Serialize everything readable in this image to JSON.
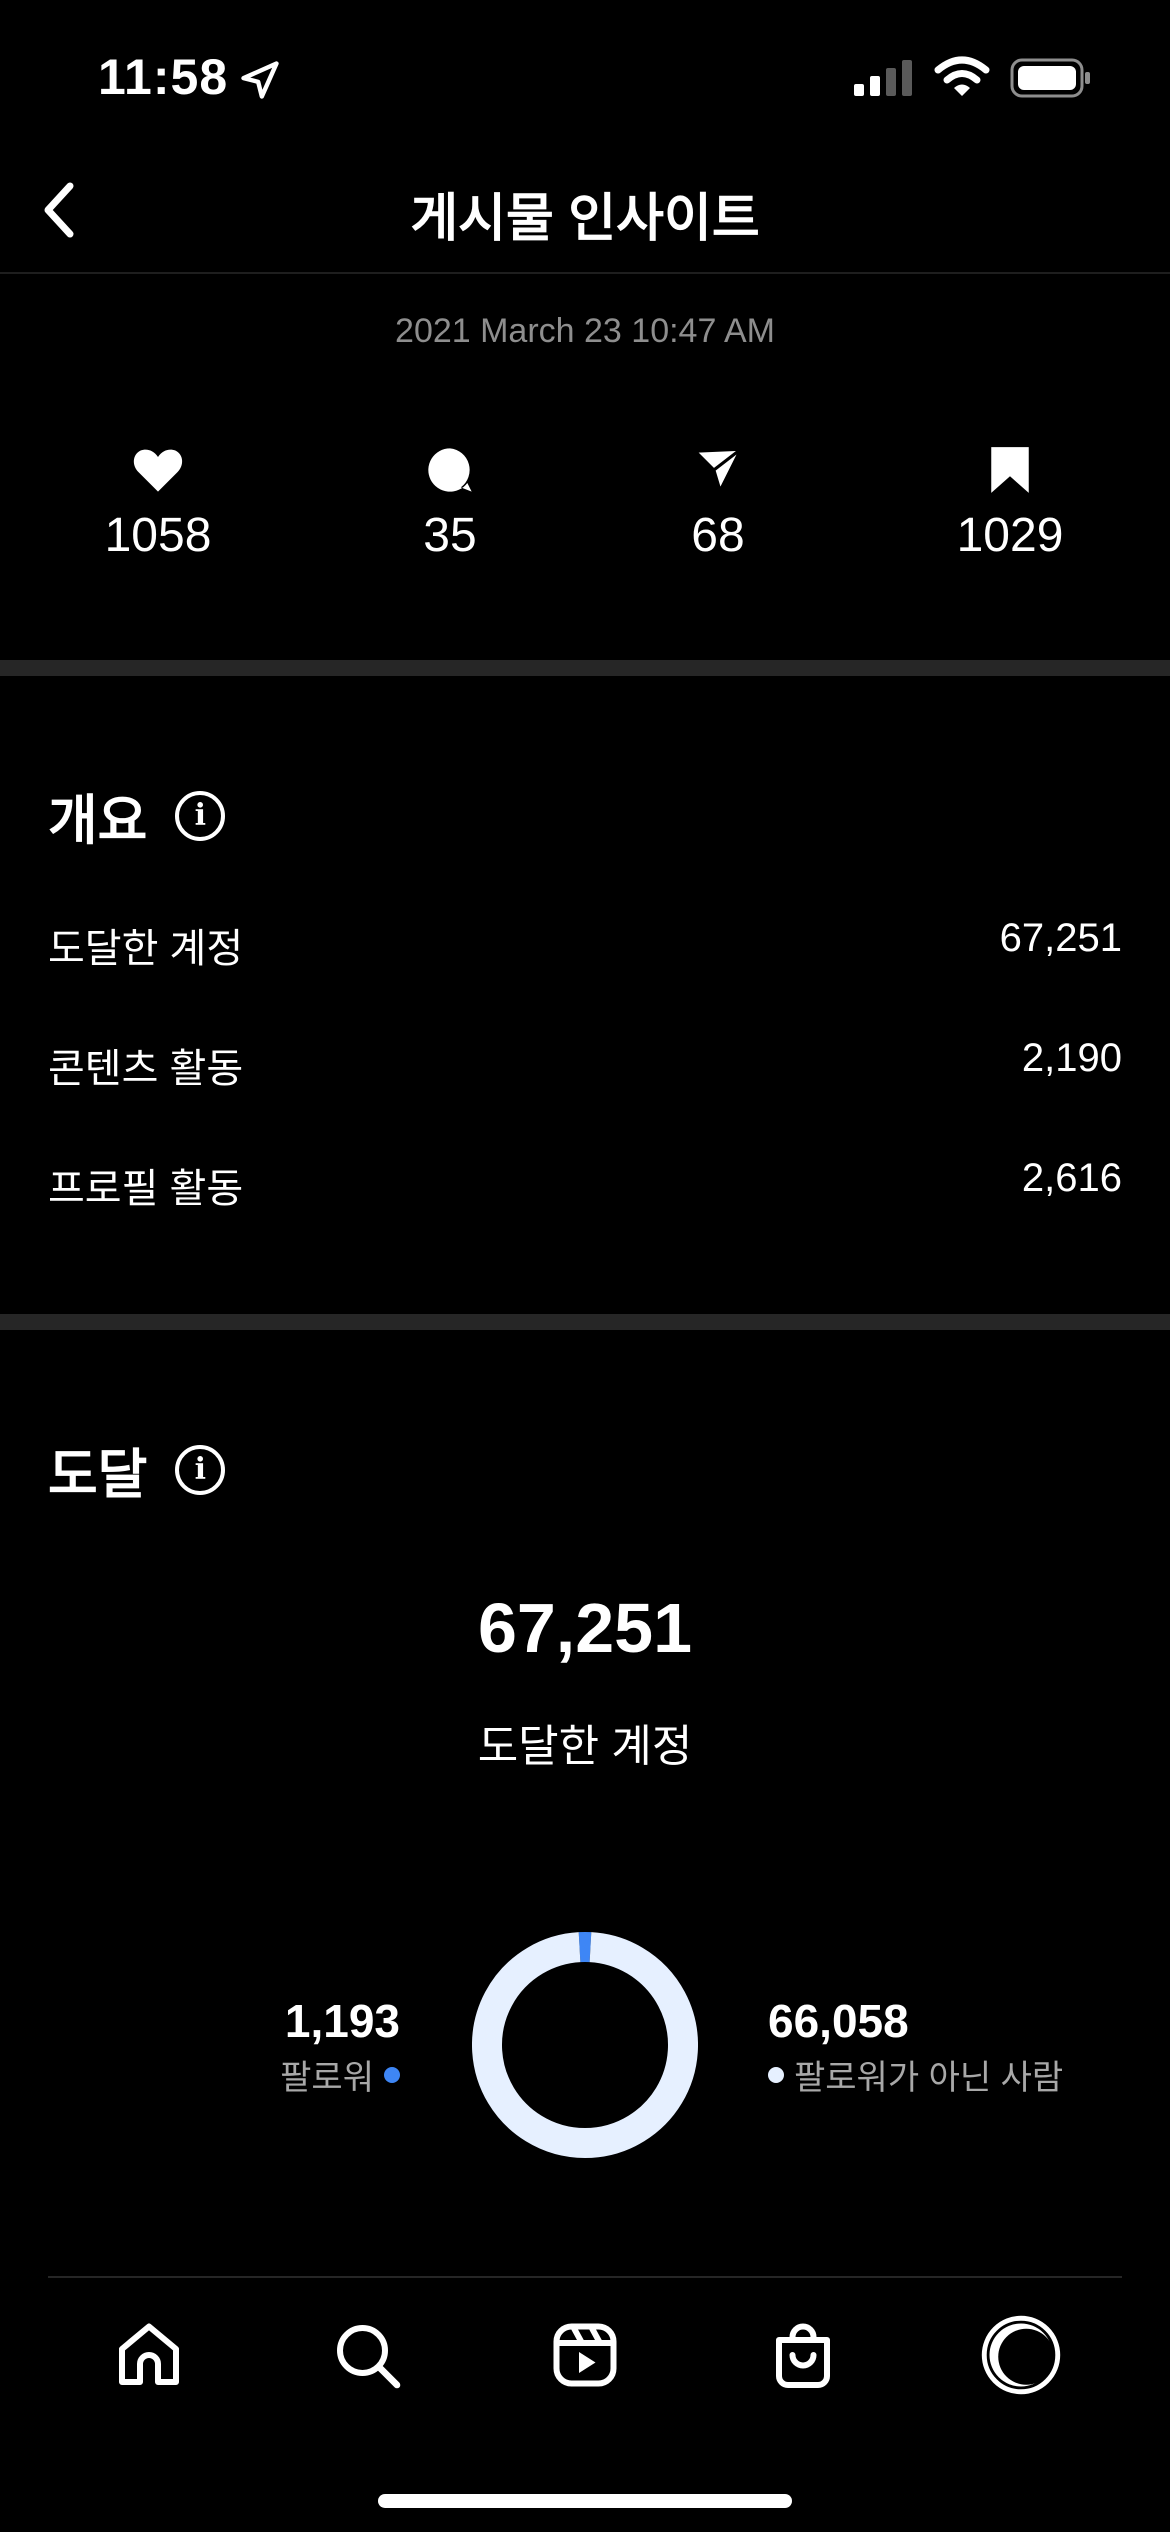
{
  "status_bar": {
    "time": "11:58",
    "icons": [
      "location-arrow-icon",
      "cellular-signal-icon",
      "wifi-icon",
      "battery-icon"
    ]
  },
  "header": {
    "title": "게시물 인사이트",
    "back_icon": "chevron-left-icon"
  },
  "post": {
    "date": "2021 March 23 10:47 AM"
  },
  "stats": [
    {
      "icon": "heart-icon",
      "value": "1058"
    },
    {
      "icon": "comment-icon",
      "value": "35"
    },
    {
      "icon": "send-icon",
      "value": "68"
    },
    {
      "icon": "bookmark-icon",
      "value": "1029"
    }
  ],
  "overview": {
    "title": "개요",
    "rows": [
      {
        "label": "도달한 계정",
        "value": "67,251"
      },
      {
        "label": "콘텐츠 활동",
        "value": "2,190"
      },
      {
        "label": "프로필 활동",
        "value": "2,616"
      }
    ]
  },
  "reach": {
    "title": "도달",
    "total": "67,251",
    "total_label": "도달한 계정",
    "followers": {
      "value": "1,193",
      "label": "팔로워",
      "color": "#3e86f5"
    },
    "non_followers": {
      "value": "66,058",
      "label": "팔로워가 아닌 사람",
      "color": "#e6f0ff"
    }
  },
  "chart_data": {
    "type": "pie",
    "categories": [
      "팔로워",
      "팔로워가 아닌 사람"
    ],
    "values": [
      1193,
      66058
    ],
    "colors": [
      "#3e86f5",
      "#e6f0ff"
    ],
    "style": "donut"
  },
  "bottom_nav": [
    {
      "icon": "home-icon"
    },
    {
      "icon": "search-icon"
    },
    {
      "icon": "reels-icon"
    },
    {
      "icon": "shop-bag-icon"
    },
    {
      "icon": "profile-avatar-icon"
    }
  ]
}
